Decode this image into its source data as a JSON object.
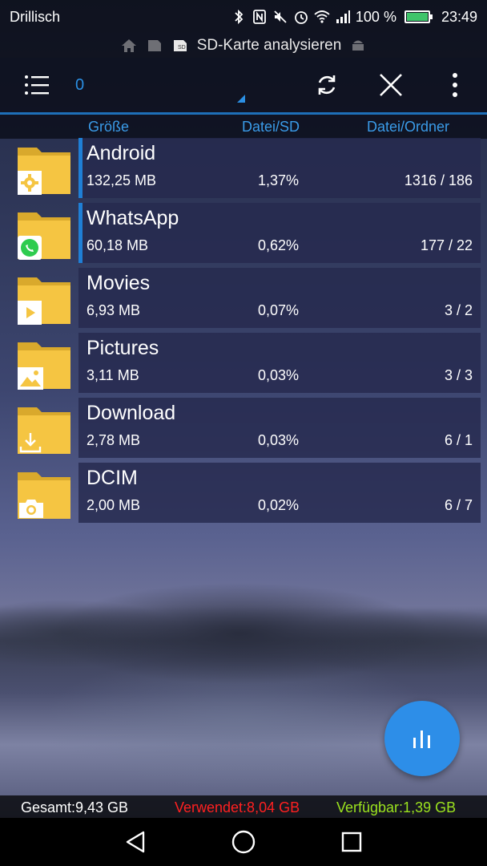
{
  "status_bar": {
    "carrier": "Drillisch",
    "battery": "100 %",
    "time": "23:49",
    "icons": [
      "bluetooth-icon",
      "nfc-icon",
      "mute-icon",
      "alarm-icon",
      "wifi-icon",
      "signal-icon",
      "battery-icon"
    ]
  },
  "breadcrumb": {
    "label": "SD-Karte analysieren",
    "icons": [
      "home-icon",
      "sd-card-icon",
      "sd-card-active-icon",
      "android-icon"
    ]
  },
  "toolbar": {
    "selection_count": "0",
    "icons": [
      "menu-icon",
      "refresh-icon",
      "close-icon",
      "more-icon"
    ]
  },
  "columns": {
    "size": "Größe",
    "file_sd": "Datei/SD",
    "file_folder": "Datei/Ordner"
  },
  "folders": [
    {
      "name": "Android",
      "size": "132,25 MB",
      "percent": "1,37%",
      "counts": "1316 / 186",
      "badge": "gear-icon",
      "marked": true
    },
    {
      "name": "WhatsApp",
      "size": "60,18 MB",
      "percent": "0,62%",
      "counts": "177 / 22",
      "badge": "whatsapp-icon",
      "marked": true
    },
    {
      "name": "Movies",
      "size": "6,93 MB",
      "percent": "0,07%",
      "counts": "3 / 2",
      "badge": "play-icon",
      "marked": false
    },
    {
      "name": "Pictures",
      "size": "3,11 MB",
      "percent": "0,03%",
      "counts": "3 / 3",
      "badge": "image-icon",
      "marked": false
    },
    {
      "name": "Download",
      "size": "2,78 MB",
      "percent": "0,03%",
      "counts": "6 / 1",
      "badge": "download-icon",
      "marked": false
    },
    {
      "name": "DCIM",
      "size": "2,00 MB",
      "percent": "0,02%",
      "counts": "6 / 7",
      "badge": "camera-icon",
      "marked": false
    }
  ],
  "summary": {
    "total": "Gesamt:9,43 GB",
    "used": "Verwendet:8,04 GB",
    "available": "Verfügbar:1,39 GB"
  },
  "colors": {
    "accent": "#2b8fe3",
    "used": "#ff2020",
    "available": "#9be21e",
    "folder": "#f5c542"
  },
  "fab": {
    "icon": "bar-chart-icon"
  },
  "nav": {
    "icons": [
      "back-icon",
      "home-circle-icon",
      "recents-icon"
    ]
  }
}
